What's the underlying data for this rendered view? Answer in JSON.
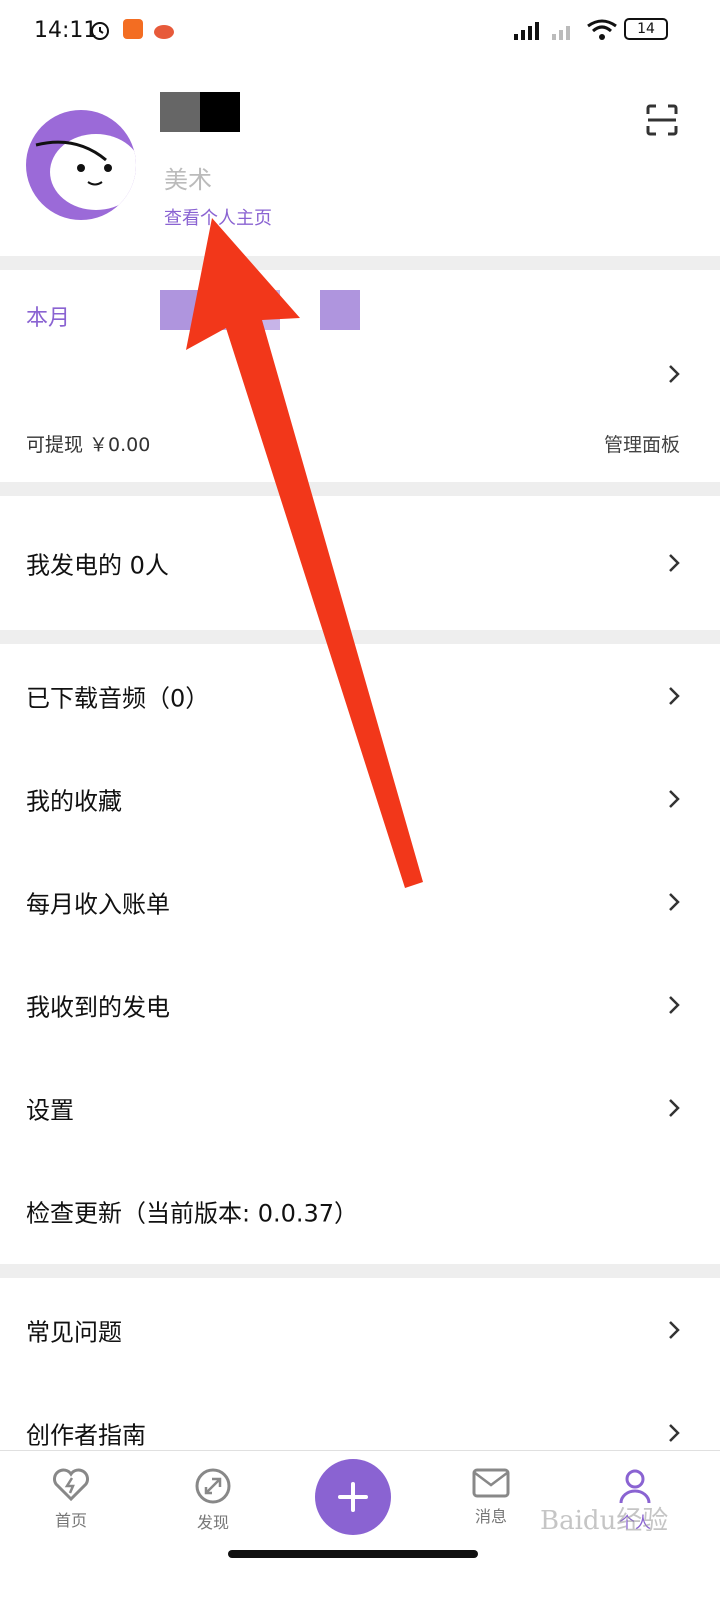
{
  "status_bar": {
    "time": "14:11",
    "battery": "14"
  },
  "profile": {
    "name": "美术",
    "view_homepage_link": "查看个人主页"
  },
  "earnings": {
    "title": "本月",
    "withdrawable": "可提现 ￥0.00",
    "manage_panel": "管理面板"
  },
  "sponsor_row": {
    "label": "我发电的  0人"
  },
  "menu": {
    "items": [
      {
        "label": "已下载音频（0）"
      },
      {
        "label": "我的收藏"
      },
      {
        "label": "每月收入账单"
      },
      {
        "label": "我收到的发电"
      },
      {
        "label": "设置"
      },
      {
        "label": "检查更新（当前版本: 0.0.37）"
      }
    ]
  },
  "help_menu": {
    "items": [
      {
        "label": "常见问题"
      },
      {
        "label": "创作者指南"
      }
    ]
  },
  "bottom_nav": {
    "home": "首页",
    "discover": "发现",
    "messages": "消息",
    "me": "个人"
  },
  "watermark": "Baidu经验",
  "colors": {
    "accent": "#8a63d2",
    "annotation_arrow": "#f2371a",
    "divider": "#eeeeee"
  }
}
